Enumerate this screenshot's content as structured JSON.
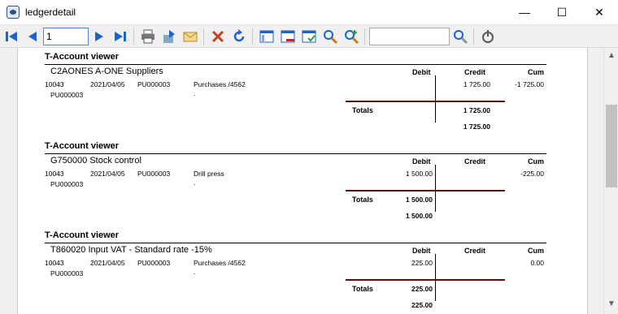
{
  "window": {
    "title": "ledgerdetail",
    "minimize": "—",
    "maximize": "☐",
    "close": "✕"
  },
  "toolbar": {
    "page_value": "1",
    "search_value": ""
  },
  "report": {
    "headers": {
      "debit": "Debit",
      "credit": "Credit",
      "cum": "Cum"
    },
    "totals_label": "Totals",
    "sections": [
      {
        "title": "T-Account viewer",
        "account": "C2AONES A-ONE Suppliers",
        "row": {
          "id": "10043",
          "date": "2021/04/05",
          "ref": "PU000003",
          "description": "Purchases /4562",
          "debit": "",
          "credit": "1 725.00",
          "cum": "-1 725.00",
          "ref2": "PU000003",
          "dot": "."
        },
        "totals": {
          "debit": "",
          "credit": "1 725.00"
        },
        "footer": {
          "debit": "",
          "credit": "1 725.00"
        }
      },
      {
        "title": "T-Account viewer",
        "account": "G750000 Stock control",
        "row": {
          "id": "10043",
          "date": "2021/04/05",
          "ref": "PU000003",
          "description": "Drill press",
          "debit": "1 500.00",
          "credit": "",
          "cum": "-225.00",
          "ref2": "PU000003",
          "dot": "."
        },
        "totals": {
          "debit": "1 500.00",
          "credit": ""
        },
        "footer": {
          "debit": "1 500.00",
          "credit": ""
        }
      },
      {
        "title": "T-Account viewer",
        "account": "T860020 Input VAT - Standard rate -15%",
        "row": {
          "id": "10043",
          "date": "2021/04/05",
          "ref": "PU000003",
          "description": "Purchases /4562",
          "debit": "225.00",
          "credit": "",
          "cum": "0.00",
          "ref2": "PU000003",
          "dot": "."
        },
        "totals": {
          "debit": "225.00",
          "credit": ""
        },
        "footer": {
          "debit": "225.00",
          "credit": ""
        }
      }
    ]
  }
}
